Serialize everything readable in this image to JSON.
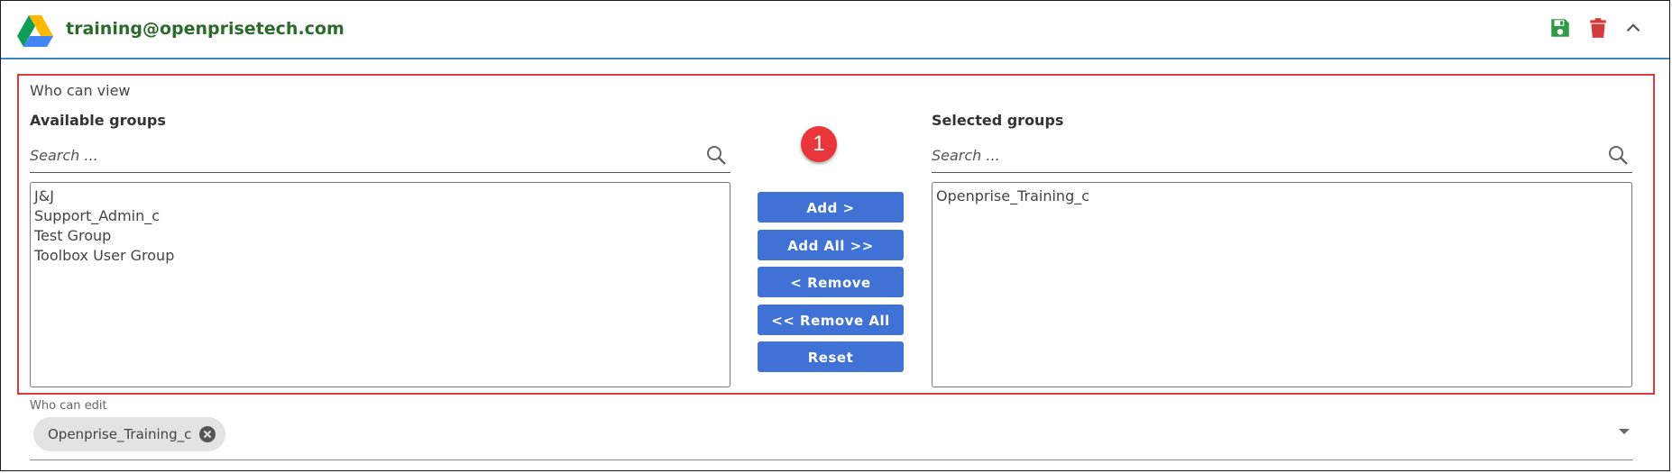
{
  "header": {
    "title": "training@openprisetech.com",
    "icons": [
      "google-drive-icon",
      "save-icon",
      "trash-icon",
      "chevron-up-icon"
    ],
    "colors": {
      "title": "#2a6a2a",
      "save": "#2e9a46",
      "trash": "#d33b3b",
      "accent_line": "#3f86c6"
    }
  },
  "who_can_view": {
    "label": "Who can view",
    "available": {
      "title": "Available groups",
      "search_placeholder": "Search ...",
      "items": [
        "J&J",
        "Support_Admin_c",
        "Test Group",
        "Toolbox User Group"
      ]
    },
    "selected": {
      "title": "Selected groups",
      "search_placeholder": "Search ...",
      "items": [
        "Openprise_Training_c"
      ]
    },
    "marker": "1",
    "buttons": {
      "add": "Add >",
      "add_all": "Add All >>",
      "remove": "< Remove",
      "remove_all": "<< Remove All",
      "reset": "Reset"
    },
    "colors": {
      "button": "#3f72d4",
      "highlight": "#e0393e",
      "marker": "#e8363a"
    }
  },
  "who_can_edit": {
    "label": "Who can edit",
    "chips": [
      "Openprise_Training_c"
    ]
  }
}
